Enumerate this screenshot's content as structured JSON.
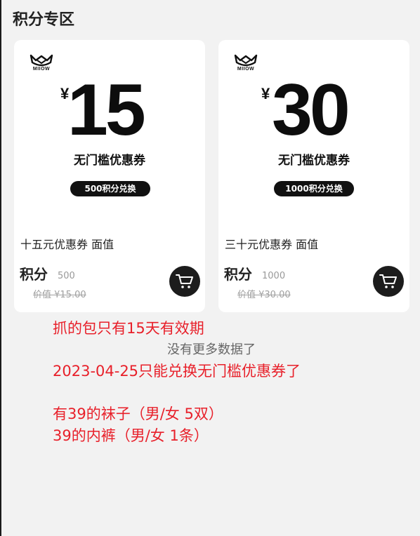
{
  "page": {
    "title": "积分专区"
  },
  "cards": [
    {
      "brand": "MIIOW",
      "currency": "¥",
      "amount": "15",
      "coupon_type": "无门槛优惠券",
      "exchange_label": "500积分兑换",
      "title": "十五元优惠券 面值",
      "points_label": "积分",
      "points_value": "500",
      "original_price": "价值 ¥15.00"
    },
    {
      "brand": "MIIOW",
      "currency": "¥",
      "amount": "30",
      "coupon_type": "无门槛优惠券",
      "exchange_label": "1000积分兑换",
      "title": "三十元优惠券 面值",
      "points_label": "积分",
      "points_value": "1000",
      "original_price": "价值 ¥30.00"
    }
  ],
  "list_end_text": "没有更多数据了",
  "annotations": [
    "抓的包只有15天有效期",
    "2023-04-25只能兑换无门槛优惠券了",
    "有39的袜子（男/女 5双）",
    "39的内裤（男/女 1条）"
  ],
  "icons": {
    "cart": "cart-icon",
    "logo": "cat-logo-icon"
  },
  "colors": {
    "annotation": "#e8202a",
    "background": "#f2f2f2",
    "button": "#1c1c1c"
  }
}
